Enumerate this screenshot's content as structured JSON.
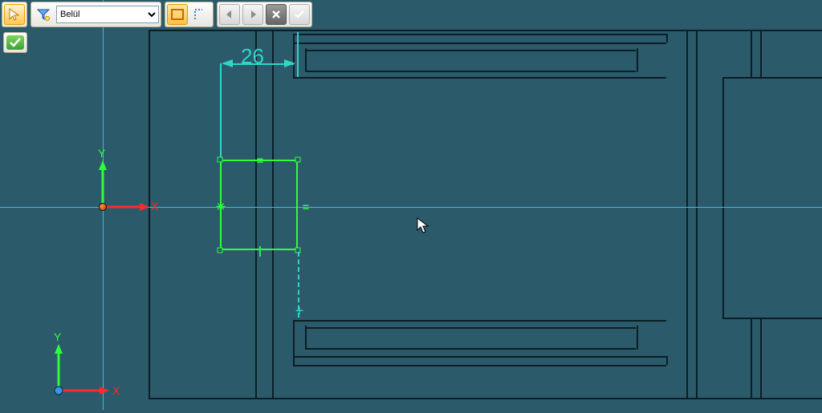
{
  "toolbar": {
    "dropdown": {
      "selected": "Belül",
      "options": [
        "Belül"
      ]
    },
    "buttons": {
      "select": "pointer",
      "filter": "filter",
      "mode_fill": "mode-fill",
      "mode_outline": "mode-outline",
      "back": "back",
      "forward": "forward",
      "cancel": "✕",
      "confirm": "✓"
    }
  },
  "dimension": {
    "value": "26"
  },
  "axes": {
    "x": "X",
    "y": "Y"
  },
  "colors": {
    "bg": "#2b5a6b",
    "sketch": "#2fff3a",
    "dim": "#2fd5c6",
    "part": "#0b1e25"
  }
}
